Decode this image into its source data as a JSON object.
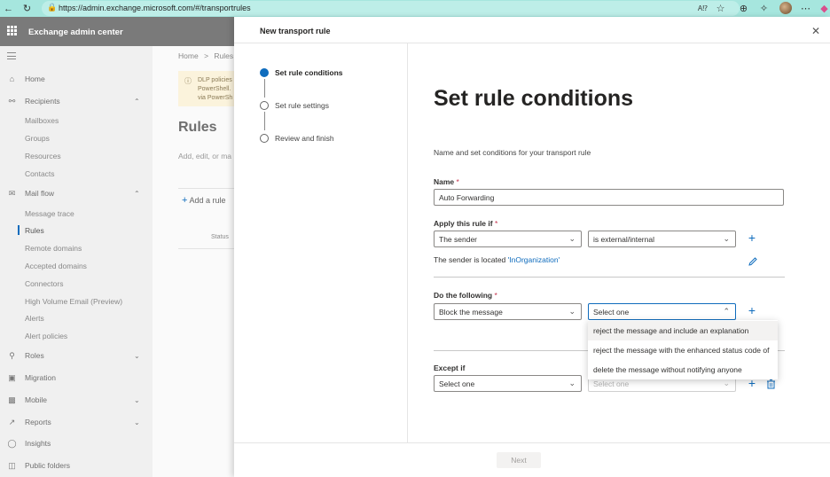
{
  "browser": {
    "url": "https://admin.exchange.microsoft.com/#/transportrules"
  },
  "app": {
    "title": "Exchange admin center"
  },
  "sidebar": {
    "items": [
      {
        "label": "Home",
        "icon": "home-icon"
      },
      {
        "label": "Recipients",
        "icon": "person-icon",
        "expanded": true
      },
      {
        "label": "Mailboxes"
      },
      {
        "label": "Groups"
      },
      {
        "label": "Resources"
      },
      {
        "label": "Contacts"
      },
      {
        "label": "Mail flow",
        "icon": "mail-icon",
        "expanded": true
      },
      {
        "label": "Message trace"
      },
      {
        "label": "Rules",
        "active": true
      },
      {
        "label": "Remote domains"
      },
      {
        "label": "Accepted domains"
      },
      {
        "label": "Connectors"
      },
      {
        "label": "High Volume Email (Preview)"
      },
      {
        "label": "Alerts"
      },
      {
        "label": "Alert policies"
      },
      {
        "label": "Roles",
        "icon": "roles-icon",
        "expanded": false
      },
      {
        "label": "Migration",
        "icon": "migration-icon"
      },
      {
        "label": "Mobile",
        "icon": "mobile-icon",
        "expanded": false
      },
      {
        "label": "Reports",
        "icon": "reports-icon",
        "expanded": false
      },
      {
        "label": "Insights",
        "icon": "insights-icon"
      },
      {
        "label": "Public folders",
        "icon": "folder-icon"
      }
    ]
  },
  "background_page": {
    "breadcrumb_home": "Home",
    "breadcrumb_sep": ">",
    "breadcrumb_current": "Rules",
    "info_line1": "DLP policies",
    "info_line2": "PowerShell.",
    "info_line3": "via PowerSh",
    "title": "Rules",
    "subtitle": "Add, edit, or ma",
    "add_rule": "Add a rule",
    "status_col": "Status"
  },
  "panel": {
    "title": "New transport rule",
    "steps": [
      {
        "label": "Set rule conditions",
        "state": "current"
      },
      {
        "label": "Set rule settings",
        "state": "pending"
      },
      {
        "label": "Review and finish",
        "state": "pending"
      }
    ],
    "heading": "Set rule conditions",
    "description": "Name and set conditions for your transport rule",
    "name_label": "Name",
    "required_mark": "*",
    "name_value": "Auto Forwarding",
    "apply_label": "Apply this rule if",
    "apply_select": "The sender",
    "apply_select2": "is external/internal",
    "sender_text": "The sender is located ",
    "sender_link": "'InOrganization'",
    "do_label": "Do the following",
    "do_select": "Block the message",
    "do_select2": "Select one",
    "dropdown_options": [
      "reject the message and include an explanation",
      "reject the message with the enhanced status code of",
      "delete the message without notifying anyone"
    ],
    "except_label": "Except if",
    "except_select": "Select one",
    "except_select2": "Select one",
    "next_button": "Next"
  },
  "colors": {
    "accent": "#0f6cbd",
    "browser_bar": "#a6e6de",
    "header": "#7a7a7a"
  }
}
